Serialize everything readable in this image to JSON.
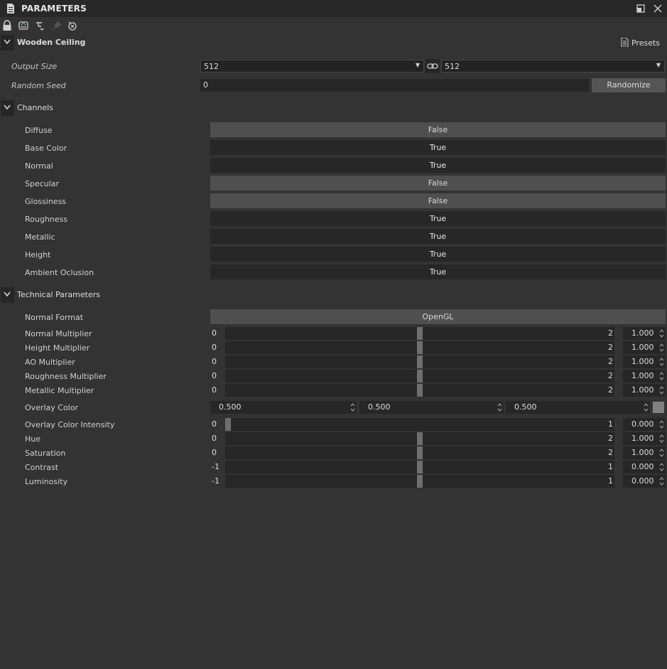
{
  "window": {
    "title": "PARAMETERS"
  },
  "toolbar": {
    "icons": [
      "lock-icon",
      "refresh-icon",
      "filter-icon",
      "pin-icon",
      "reset-icon"
    ]
  },
  "header": {
    "graph_name": "Wooden Ceiling",
    "presets_label": "Presets"
  },
  "output_size": {
    "label": "Output Size",
    "value_x": "512",
    "value_y": "512"
  },
  "random_seed": {
    "label": "Random Seed",
    "value": "0",
    "button_label": "Randomize"
  },
  "channels": {
    "title": "Channels",
    "items": [
      {
        "label": "Diffuse",
        "value": "False"
      },
      {
        "label": "Base Color",
        "value": "True"
      },
      {
        "label": "Normal",
        "value": "True"
      },
      {
        "label": "Specular",
        "value": "False"
      },
      {
        "label": "Glossiness",
        "value": "False"
      },
      {
        "label": "Roughness",
        "value": "True"
      },
      {
        "label": "Metallic",
        "value": "True"
      },
      {
        "label": "Height",
        "value": "True"
      },
      {
        "label": "Ambient Oclusion",
        "value": "True"
      }
    ]
  },
  "technical": {
    "title": "Technical Parameters",
    "normal_format": {
      "label": "Normal Format",
      "value": "OpenGL"
    },
    "sliders_a": [
      {
        "label": "Normal Multiplier",
        "min": "0",
        "max": "2",
        "value": "1.000",
        "fraction": 0.5
      },
      {
        "label": "Height Multiplier",
        "min": "0",
        "max": "2",
        "value": "1.000",
        "fraction": 0.5
      },
      {
        "label": "AO Multiplier",
        "min": "0",
        "max": "2",
        "value": "1.000",
        "fraction": 0.5
      },
      {
        "label": "Roughness Multiplier",
        "min": "0",
        "max": "2",
        "value": "1.000",
        "fraction": 0.5
      },
      {
        "label": "Metallic Multiplier",
        "min": "0",
        "max": "2",
        "value": "1.000",
        "fraction": 0.5
      }
    ],
    "overlay_color": {
      "label": "Overlay Color",
      "r": "0.500",
      "g": "0.500",
      "b": "0.500",
      "swatch": "#808080"
    },
    "sliders_b": [
      {
        "label": "Overlay Color Intensity",
        "min": "0",
        "max": "1",
        "value": "0.000",
        "fraction": 0.0
      },
      {
        "label": "Hue",
        "min": "0",
        "max": "2",
        "value": "1.000",
        "fraction": 0.5
      },
      {
        "label": "Saturation",
        "min": "0",
        "max": "2",
        "value": "1.000",
        "fraction": 0.5
      },
      {
        "label": "Contrast",
        "min": "-1",
        "max": "1",
        "value": "0.000",
        "fraction": 0.5
      },
      {
        "label": "Luminosity",
        "min": "-1",
        "max": "1",
        "value": "0.000",
        "fraction": 0.5
      }
    ]
  }
}
